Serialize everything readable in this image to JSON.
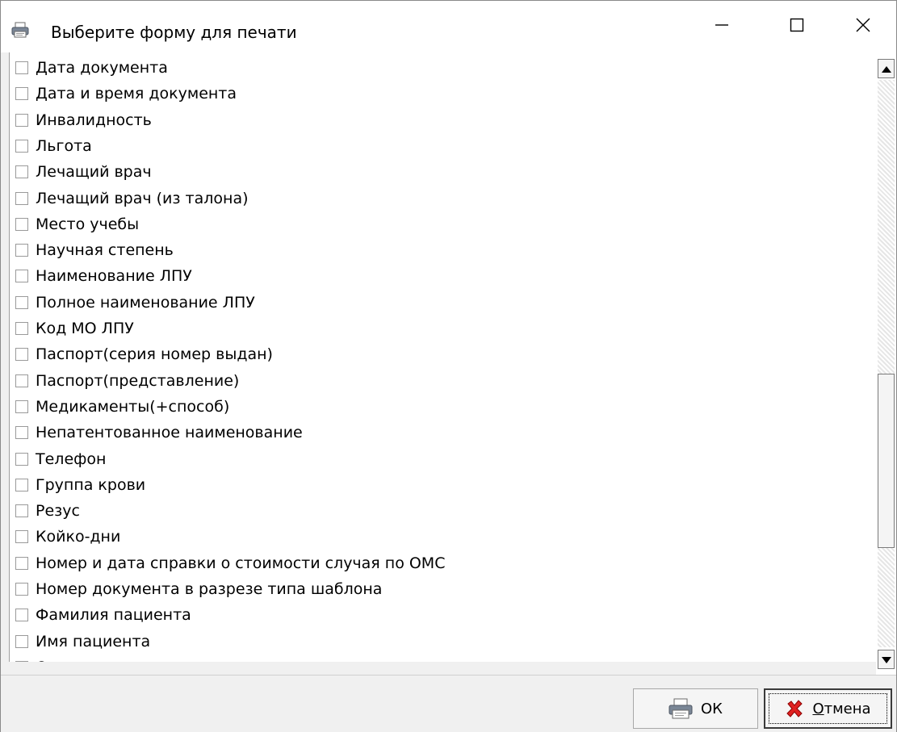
{
  "window": {
    "title": "Выберите форму для печати",
    "icon": "printer-icon",
    "controls": {
      "minimize": "minimize-icon",
      "maximize": "maximize-icon",
      "close": "close-icon"
    }
  },
  "list": {
    "items": [
      {
        "label": "Дата документа",
        "checked": false
      },
      {
        "label": "Дата и время документа",
        "checked": false
      },
      {
        "label": "Инвалидность",
        "checked": false
      },
      {
        "label": "Льгота",
        "checked": false
      },
      {
        "label": "Лечащий врач",
        "checked": false
      },
      {
        "label": "Лечащий врач (из талона)",
        "checked": false
      },
      {
        "label": "Место учебы",
        "checked": false
      },
      {
        "label": "Научная степень",
        "checked": false
      },
      {
        "label": "Наименование ЛПУ",
        "checked": false
      },
      {
        "label": "Полное наименование ЛПУ",
        "checked": false
      },
      {
        "label": "Код МО ЛПУ",
        "checked": false
      },
      {
        "label": "Паспорт(серия номер выдан)",
        "checked": false
      },
      {
        "label": "Паспорт(представление)",
        "checked": false
      },
      {
        "label": "Медикаменты(+способ)",
        "checked": false
      },
      {
        "label": "Непатентованное наименование",
        "checked": false
      },
      {
        "label": "Телефон",
        "checked": false
      },
      {
        "label": "Группа крови",
        "checked": false
      },
      {
        "label": "Резус",
        "checked": false
      },
      {
        "label": "Койко-дни",
        "checked": false
      },
      {
        "label": "Номер и дата справки о стоимости случая по ОМС",
        "checked": false
      },
      {
        "label": "Номер документа в разрезе типа шаблона",
        "checked": false
      },
      {
        "label": "Фамилия пациента",
        "checked": false
      },
      {
        "label": "Имя пациента",
        "checked": false
      },
      {
        "label": "Отчество пациента",
        "checked": false
      }
    ]
  },
  "buttons": {
    "ok_label": "ОК",
    "cancel_label": "Отмена"
  },
  "colors": {
    "cancel_icon": "#e02020",
    "printer_icon": "#3a6fb0"
  }
}
